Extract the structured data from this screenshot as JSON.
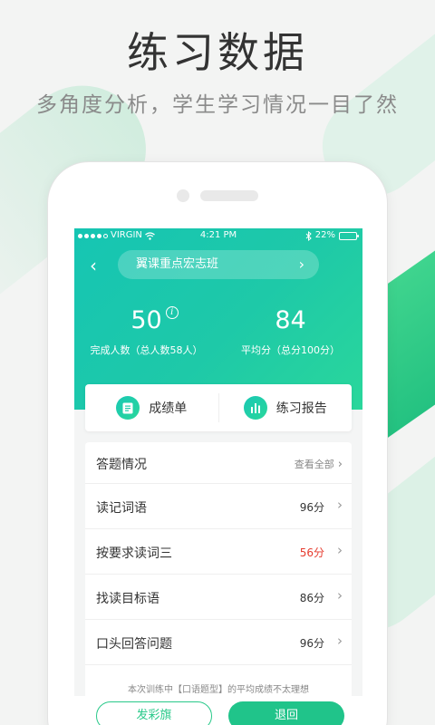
{
  "hero": {
    "title": "练习数据",
    "subtitle": "多角度分析，学生学习情况一目了然"
  },
  "status_bar": {
    "carrier": "VIRGIN",
    "time": "4:21 PM",
    "battery": "22%",
    "battery_level": 0.22
  },
  "header": {
    "class_name": "翼课重点宏志班",
    "stats": [
      {
        "value": "50",
        "label": "完成人数（总人数58人）"
      },
      {
        "value": "84",
        "label": "平均分（总分100分）"
      }
    ]
  },
  "actions": [
    {
      "label": "成绩单",
      "icon": "report-card-icon"
    },
    {
      "label": "练习报告",
      "icon": "bar-chart-icon"
    }
  ],
  "answers": {
    "title": "答题情况",
    "view_all": "查看全部",
    "rows": [
      {
        "label": "读记词语",
        "score": "96分"
      },
      {
        "label": "按要求读词三",
        "score": "56分"
      },
      {
        "label": "找读目标语",
        "score": "86分"
      },
      {
        "label": "口头回答问题",
        "score": "96分"
      }
    ],
    "note": "本次训练中【口语题型】的平均成绩不太理想"
  },
  "buttons": {
    "flag": "发彩旗",
    "back": "退回"
  },
  "colors": {
    "accent": "#20c48a",
    "warn": "#e63b2e",
    "header_start": "#16c5b3",
    "header_end": "#2ad79b"
  }
}
